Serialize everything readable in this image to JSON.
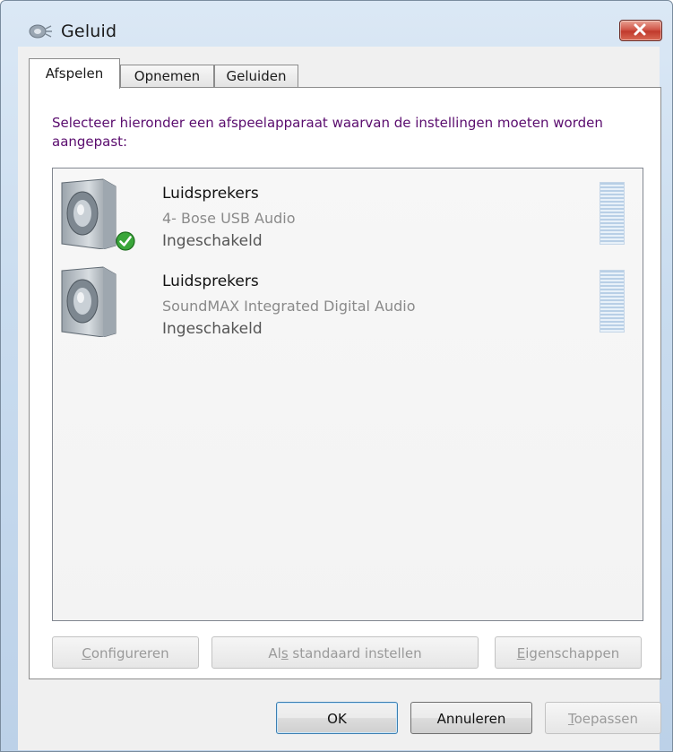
{
  "window": {
    "title": "Geluid"
  },
  "tabs": [
    {
      "label": "Afspelen",
      "active": true
    },
    {
      "label": "Opnemen",
      "active": false
    },
    {
      "label": "Geluiden",
      "active": false
    }
  ],
  "instruction": "Selecteer hieronder een afspeelapparaat waarvan de instellingen moeten worden aangepast:",
  "devices": [
    {
      "name": "Luidsprekers",
      "description": "4- Bose USB Audio",
      "status": "Ingeschakeld",
      "is_default": true,
      "icon": "speaker-icon"
    },
    {
      "name": "Luidsprekers",
      "description": "SoundMAX Integrated Digital Audio",
      "status": "Ingeschakeld",
      "is_default": false,
      "icon": "speaker-icon"
    }
  ],
  "panel_buttons": {
    "configure": {
      "pre": "",
      "accel": "C",
      "post": "onfigureren"
    },
    "set_default": {
      "pre": "Al",
      "accel": "s",
      "post": " standaard instellen"
    },
    "properties": {
      "pre": "",
      "accel": "E",
      "post": "igenschappen"
    }
  },
  "dialog_buttons": {
    "ok": "OK",
    "cancel": "Annuleren",
    "apply": {
      "pre": "",
      "accel": "T",
      "post": "oepassen"
    }
  },
  "colors": {
    "instruction_text": "#5a0c6e",
    "close_button": "#c13a2c"
  }
}
